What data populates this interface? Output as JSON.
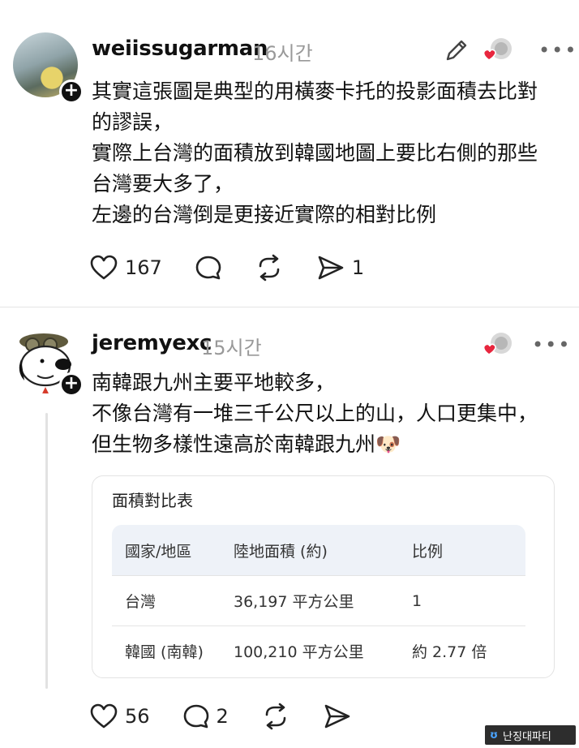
{
  "posts": [
    {
      "username": "weiissugarman",
      "time": "16시간",
      "lines": "其實這張圖是典型的用橫麥卡托的投影面積去比對\n的謬誤，\n實際上台灣的面積放到韓國地圖上要比右側的那些\n台灣要大多了，\n左邊的台灣倒是更接近實際的相對比例",
      "likes": "167",
      "comments": "",
      "shares": "1"
    },
    {
      "username": "jeremyexc",
      "time": "15시간",
      "lines": "南韓跟九州主要平地較多，\n不像台灣有一堆三千公尺以上的山，人口更集中，\n但生物多樣性遠高於南韓跟九州🐶",
      "table": {
        "title": "面積對比表",
        "headers": [
          "國家/地區",
          "陸地面積 (約)",
          "比例"
        ],
        "rows": [
          [
            "台灣",
            "36,197 平方公里",
            "1"
          ],
          [
            "韓國 (南韓)",
            "100,210 平方公里",
            "約 2.77 倍"
          ]
        ]
      },
      "likes": "56",
      "comments": "2",
      "shares": ""
    }
  ],
  "watermark": "난징대파티",
  "colors": {
    "heart_red": "#e8263e",
    "muted": "#999999",
    "table_header_bg": "#eef2f8"
  }
}
